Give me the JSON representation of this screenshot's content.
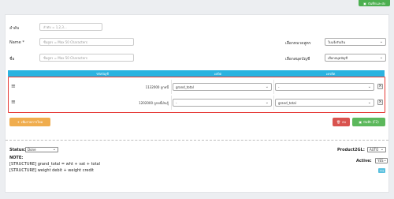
{
  "toolbar": {
    "top_button_label": "บันทึกและส่ง"
  },
  "form": {
    "seq_label": "ลำดับ",
    "seq_placeholder": "ลำดับ = 1,2,3...",
    "name_label": "Name *",
    "name_placeholder": "ชื่อสูตร = Max 50 Characters",
    "name2_label": "ชื่อ",
    "name2_placeholder": "ชื่อสูตร = Max 50 Characters",
    "category_label": "เลือกหมวดสูตร",
    "category_value": "ใบแจ้งรับเงิน",
    "group_label": "เลือกสมุดบัญชี",
    "group_value": "เลือกสมุดบัญชี"
  },
  "table": {
    "headers": [
      "รหัสบัญชี",
      "เดบิต",
      "เครดิต"
    ],
    "rows": [
      {
        "account": "1132000 ลูกหนี้",
        "debit": "grand_total",
        "credit": "-"
      },
      {
        "account": "1202000 ลูกหนี้เงินกู้",
        "debit": "-",
        "credit": "grand_total"
      }
    ]
  },
  "buttons": {
    "add_row": "เพิ่มรายการใหม่",
    "delete": "ลบ",
    "save": "บันทึก (F2)"
  },
  "footer": {
    "status_label": "Status:",
    "status_value": "Done",
    "note_label": "NOTE:",
    "structure_1": "[STRUCTURE] grand_total = wht + vat + total",
    "structure_2": "[STRUCTURE] weight debit + weight credit",
    "product2gl_label": "Product2GL:",
    "product2gl_value": "AUTO",
    "active_label": "Active:",
    "active_value": "YES",
    "badge": "Log"
  },
  "colors": {
    "header_blue": "#2bb3e0",
    "highlight_red": "#e53935",
    "add_orange": "#f0ad4e",
    "delete_red": "#d9534f",
    "save_green": "#5cb85c"
  }
}
